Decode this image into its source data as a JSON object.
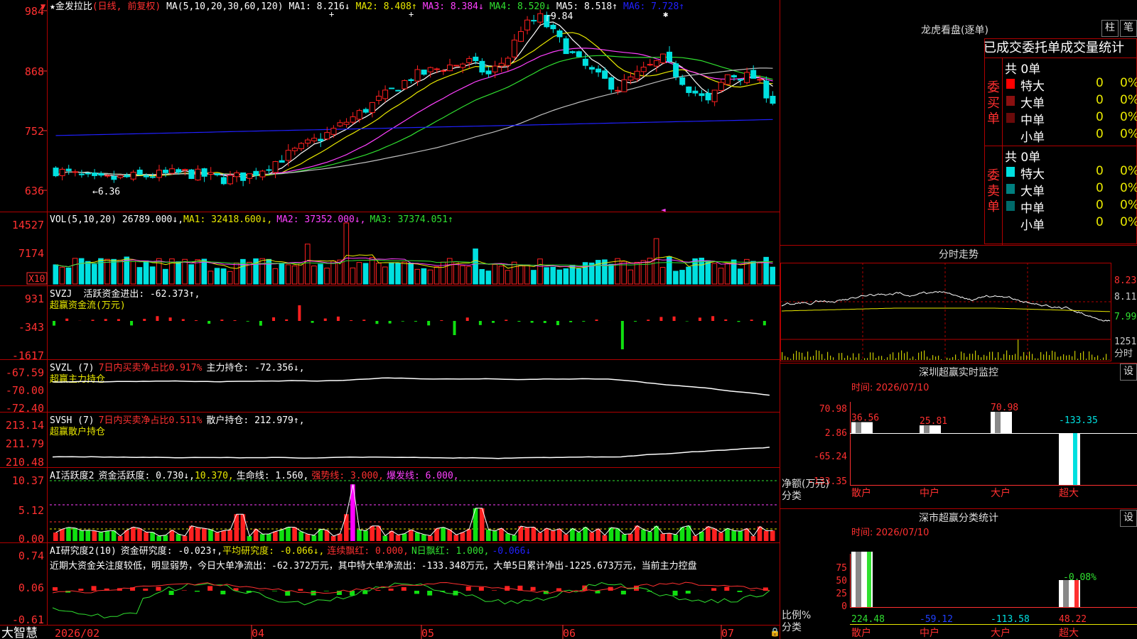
{
  "colors": {
    "up": "#ff2020",
    "down": "#00e0e0",
    "ma1": "#ffffff",
    "ma2": "#e8e800",
    "ma3": "#ff40ff",
    "ma4": "#30e030",
    "ma5": "#c0c0c0",
    "ma6": "#2020ff",
    "grid": "#b00000"
  },
  "main": {
    "star": "★",
    "name": "金发拉比",
    "mode": "(日线, 前复权)",
    "ma_head": "MA(5,10,20,30,60,120)",
    "ma1": "MA1: 8.216↓",
    "ma2": "MA2: 8.408↑",
    "ma3": "MA3: 8.384↓",
    "ma4": "MA4: 8.520↓",
    "ma5": "MA5: 8.518↑",
    "ma6": "MA6: 7.728↑",
    "yticks": [
      "984",
      "868",
      "752",
      "636"
    ],
    "high_label": "9.84",
    "low_label": "6.36"
  },
  "vol": {
    "head": "VOL(5,10,20)",
    "v": "26789.000↓,",
    "ma1": "MA1: 32418.600↓,",
    "ma2": "MA2: 37352.000↓,",
    "ma3": "MA3: 37374.051↑",
    "yticks": [
      "14527",
      "7174"
    ],
    "unit": "X10"
  },
  "svzj": {
    "head": "SVZJ",
    "t1": "活跃资金进出: -62.373↑,",
    "t2": "超赢资金流(万元)",
    "yticks": [
      "931",
      "-343",
      "-1617"
    ]
  },
  "svzl": {
    "head": "SVZL (7)",
    "t1": "7日内买卖净占比0.917%",
    "t2": "主力持仓: -72.356↓,",
    "t3": "超赢主力持仓",
    "yticks": [
      "-67.59",
      "-70.00",
      "-72.40"
    ]
  },
  "svsh": {
    "head": "SVSH (7)",
    "t1": "7日内买卖净占比0.511%",
    "t2": "散户持仓: 212.979↑,",
    "t3": "超赢散户持仓",
    "yticks": [
      "213.14",
      "211.79",
      "210.48"
    ]
  },
  "ai1": {
    "head": "AI活跃度2",
    "t1": "资金活跃度: 0.730↓,",
    "t2": "10.370,",
    "t3": "生命线: 1.560,",
    "t4": "强势线: 3.000,",
    "t5": "爆发线: 6.000,",
    "yticks": [
      "10.37",
      "5.12",
      "0.00"
    ]
  },
  "ai2": {
    "head": "AI研究度2(10)",
    "t1": "资金研究度: -0.023↑,",
    "t2": "平均研究度: -0.066↓,",
    "t3": "连续飘红: 0.000,",
    "t4": "N日飘红: 1.000,",
    "t5": "-0.066↓",
    "summary": "近期大资金关注度较低，明显弱势，今日大单净流出：-62.372万元，其中特大单净流出：-133.348万元，大单5日累计净出-1225.673万元，当前主力控盘",
    "yticks": [
      "0.74",
      "0.06",
      "-0.61"
    ]
  },
  "bottom": {
    "brand": "大智慧",
    "dates": [
      "2026/02",
      "04",
      "05",
      "06",
      "07"
    ]
  },
  "lhb": {
    "title": "龙虎看盘(逐单)",
    "btn1": "柱",
    "btn2": "笔",
    "subtitle": "已成交委托单成交量统计",
    "buy_label": "委买单",
    "sell_label": "委卖单",
    "buy_total": "共 0单",
    "sell_total": "共 0单",
    "buy_rows": [
      {
        "name": "特大",
        "n": "0",
        "p": "0%"
      },
      {
        "name": "大单",
        "n": "0",
        "p": "0%"
      },
      {
        "name": "中单",
        "n": "0",
        "p": "0%"
      },
      {
        "name": "小单",
        "n": "0",
        "p": "0%"
      }
    ],
    "sell_rows": [
      {
        "name": "特大",
        "n": "0",
        "p": "0%"
      },
      {
        "name": "大单",
        "n": "0",
        "p": "0%"
      },
      {
        "name": "中单",
        "n": "0",
        "p": "0%"
      },
      {
        "name": "小单",
        "n": "0",
        "p": "0%"
      }
    ]
  },
  "fenshi": {
    "title": "分时走势",
    "yticks": [
      "8.23",
      "8.11",
      "7.99"
    ],
    "vol_tick": "1251",
    "vol_label": "分时"
  },
  "monitor": {
    "title": "深圳超赢实时监控",
    "btn": "设",
    "time": "时间: 2026/07/10",
    "yticks": [
      "70.98",
      "2.86",
      "-65.24",
      "-133.35"
    ],
    "bars": [
      {
        "cat": "散户",
        "value": 36.56,
        "label": "36.56"
      },
      {
        "cat": "中户",
        "value": 25.81,
        "label": "25.81"
      },
      {
        "cat": "大户",
        "value": 70.98,
        "label": "70.98"
      },
      {
        "cat": "超大",
        "value": -133.35,
        "label": "-133.35"
      }
    ],
    "unit": "净额(万元)",
    "cls": "分类"
  },
  "classify": {
    "title": "深市超赢分类统计",
    "btn": "设",
    "time": "时间: 2026/07/10",
    "yticks": [
      "75",
      "50",
      "25",
      "0"
    ],
    "top_label": "-0.08%",
    "vals": [
      "224.48",
      "-59.12",
      "-113.58",
      "48.22"
    ],
    "cats": [
      "散户",
      "中户",
      "大户",
      "超大"
    ],
    "unit": "比例%",
    "cls": "分类"
  }
}
